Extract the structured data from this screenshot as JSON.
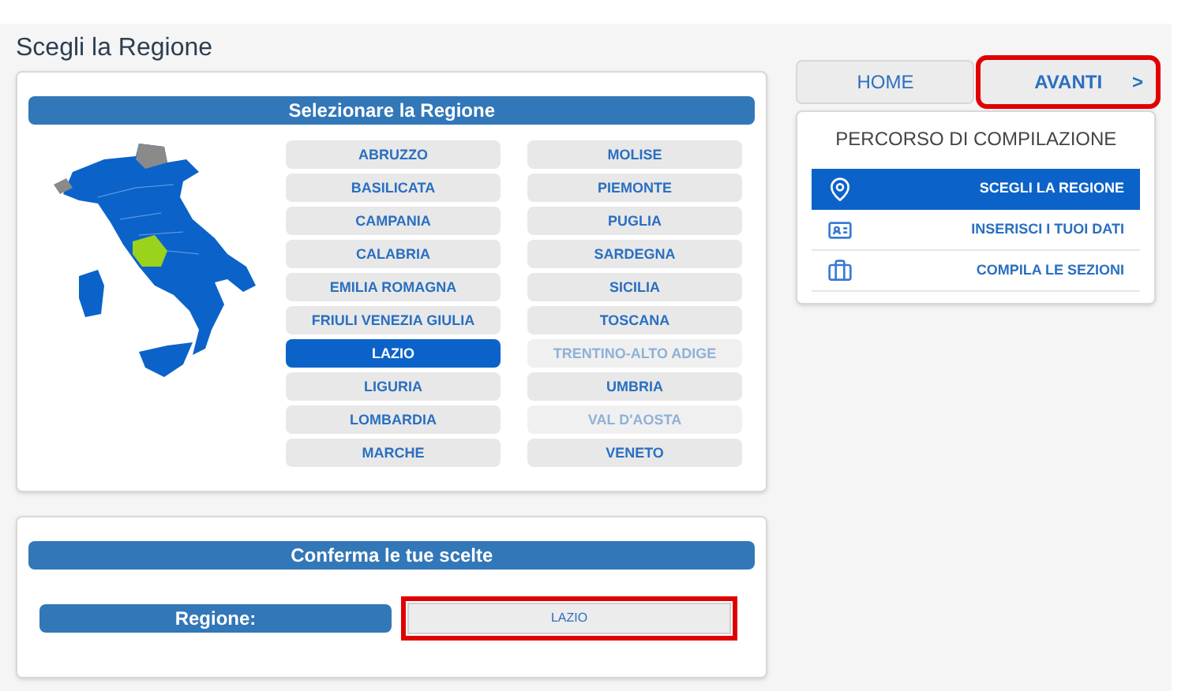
{
  "page_title": "Scegli la Regione",
  "selection_panel": {
    "header": "Selezionare la Regione",
    "regions": [
      {
        "label": "ABRUZZO",
        "selected": false,
        "disabled": false
      },
      {
        "label": "BASILICATA",
        "selected": false,
        "disabled": false
      },
      {
        "label": "CAMPANIA",
        "selected": false,
        "disabled": false
      },
      {
        "label": "CALABRIA",
        "selected": false,
        "disabled": false
      },
      {
        "label": "EMILIA ROMAGNA",
        "selected": false,
        "disabled": false
      },
      {
        "label": "FRIULI VENEZIA GIULIA",
        "selected": false,
        "disabled": false
      },
      {
        "label": "LAZIO",
        "selected": true,
        "disabled": false
      },
      {
        "label": "LIGURIA",
        "selected": false,
        "disabled": false
      },
      {
        "label": "LOMBARDIA",
        "selected": false,
        "disabled": false
      },
      {
        "label": "MARCHE",
        "selected": false,
        "disabled": false
      },
      {
        "label": "MOLISE",
        "selected": false,
        "disabled": false
      },
      {
        "label": "PIEMONTE",
        "selected": false,
        "disabled": false
      },
      {
        "label": "PUGLIA",
        "selected": false,
        "disabled": false
      },
      {
        "label": "SARDEGNA",
        "selected": false,
        "disabled": false
      },
      {
        "label": "SICILIA",
        "selected": false,
        "disabled": false
      },
      {
        "label": "TOSCANA",
        "selected": false,
        "disabled": false
      },
      {
        "label": "TRENTINO-ALTO ADIGE",
        "selected": false,
        "disabled": true
      },
      {
        "label": "UMBRIA",
        "selected": false,
        "disabled": false
      },
      {
        "label": "VAL D'AOSTA",
        "selected": false,
        "disabled": true
      },
      {
        "label": "VENETO",
        "selected": false,
        "disabled": false
      }
    ]
  },
  "confirm_panel": {
    "header": "Conferma le tue scelte",
    "label": "Regione:",
    "value": "LAZIO",
    "highlighted": true
  },
  "nav_buttons": [
    {
      "label": "HOME",
      "highlighted": false
    },
    {
      "label": "AVANTI",
      "arrow": ">",
      "highlighted": true
    }
  ],
  "steps_panel": {
    "title": "PERCORSO DI COMPILAZIONE",
    "steps": [
      {
        "label": "SCEGLI LA REGIONE",
        "kind": "pin",
        "selected": true
      },
      {
        "label": "INSERISCI I TUOI DATI",
        "kind": "card",
        "selected": false
      },
      {
        "label": "COMPILA LE SEZIONI",
        "kind": "briefcase",
        "selected": false
      }
    ]
  }
}
